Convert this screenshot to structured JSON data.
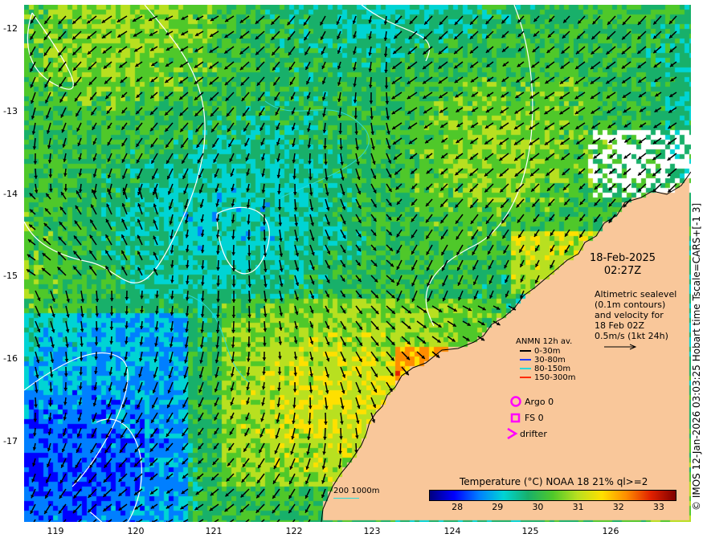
{
  "map": {
    "lon_ticks": [
      "119",
      "120",
      "121",
      "122",
      "123",
      "124",
      "125",
      "126"
    ],
    "lat_ticks": [
      "-12",
      "-13",
      "-14",
      "-15",
      "-16",
      "-17"
    ],
    "lon_range": [
      118.7,
      126.95
    ],
    "lat_range": [
      -11.95,
      -17.98
    ],
    "land_color": "#f9c79a",
    "cloud_color": "#ffffff"
  },
  "date": {
    "day": "18-Feb-2025",
    "time": "02:27Z"
  },
  "altimetry_note": {
    "line1": "Altimetric sealevel",
    "line2": "(0.1m contours)",
    "line3": "and velocity for",
    "line4": "18 Feb 02Z",
    "line5": "0.5m/s (1kt 24h)"
  },
  "anmn_legend": {
    "title": "ANMN 12h av.",
    "items": [
      {
        "label": "0-30m",
        "color": "#000000"
      },
      {
        "label": "30-80m",
        "color": "#1f3cff"
      },
      {
        "label": "80-150m",
        "color": "#29d9d9"
      },
      {
        "label": "150-300m",
        "color": "#ff2a00"
      }
    ]
  },
  "markers": {
    "argo": "Argo 0",
    "fs": "FS 0",
    "drifter": "drifter",
    "marker_color": "#ff00ff"
  },
  "bathy_label": {
    "first": "200",
    "second": "1000m"
  },
  "colorbar": {
    "title": "Temperature (°C) NOAA 18 21% ql>=2",
    "ticks": [
      "28",
      "29",
      "30",
      "31",
      "32",
      "33"
    ],
    "range": [
      27.3,
      33.4
    ],
    "colors": [
      "#00007f",
      "#0000ff",
      "#007fff",
      "#00d4d4",
      "#18b06a",
      "#4fc82a",
      "#b8e020",
      "#ffe000",
      "#ff8c00",
      "#e02000",
      "#7f0000"
    ]
  },
  "copyright": "© IMOS 12-Jan-2026 03:03:25 Hobart time Tscale=CARS+[-1 3]"
}
